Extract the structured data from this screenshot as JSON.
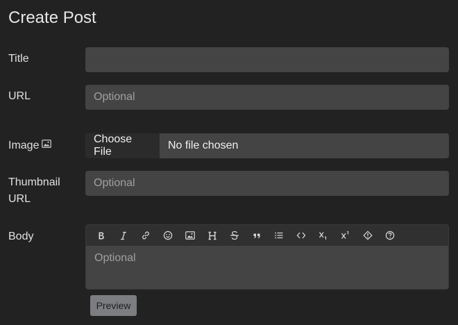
{
  "page": {
    "title": "Create Post"
  },
  "form": {
    "title_label": "Title",
    "title_value": "",
    "url_label": "URL",
    "url_placeholder": "Optional",
    "image_label": "Image",
    "file_button_label": "Choose File",
    "file_status": "No file chosen",
    "thumbnail_label_line1": "Thumbnail",
    "thumbnail_label_line2": "URL",
    "thumbnail_placeholder": "Optional",
    "body_label": "Body",
    "body_placeholder": "Optional",
    "preview_label": "Preview"
  },
  "toolbar": {
    "buttons": [
      {
        "name": "bold",
        "icon": "bold-icon"
      },
      {
        "name": "italic",
        "icon": "italic-icon"
      },
      {
        "name": "link",
        "icon": "link-icon"
      },
      {
        "name": "emoji",
        "icon": "emoji-icon"
      },
      {
        "name": "image",
        "icon": "image-icon"
      },
      {
        "name": "header",
        "icon": "heading-icon"
      },
      {
        "name": "strikethrough",
        "icon": "strikethrough-icon"
      },
      {
        "name": "quote",
        "icon": "quote-icon"
      },
      {
        "name": "list",
        "icon": "list-icon"
      },
      {
        "name": "code",
        "icon": "code-icon"
      },
      {
        "name": "subscript",
        "icon": "subscript-icon"
      },
      {
        "name": "superscript",
        "icon": "superscript-icon"
      },
      {
        "name": "spoiler",
        "icon": "spoiler-icon"
      },
      {
        "name": "help",
        "icon": "help-icon"
      }
    ]
  },
  "colors": {
    "background": "#222222",
    "input_background": "#444444",
    "toolbar_background": "#303030",
    "preview_button": "#7b7d80"
  }
}
